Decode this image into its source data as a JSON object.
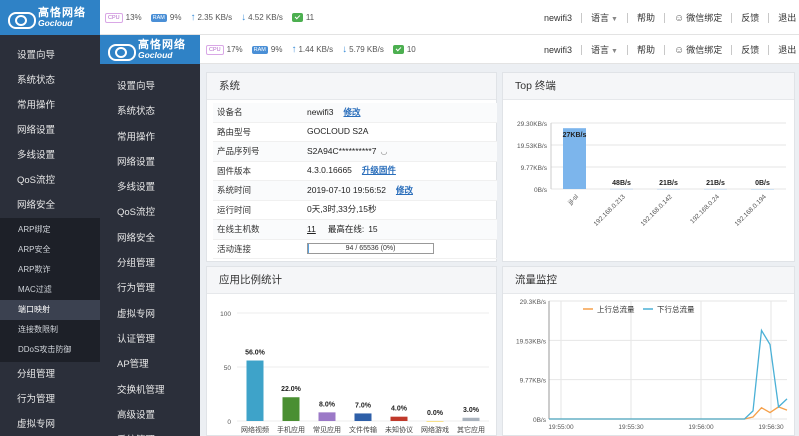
{
  "brand": {
    "name_cn": "高恪网络",
    "name_en": "Gocloud"
  },
  "header_bg": {
    "cpu": "13%",
    "ram": "9%",
    "upload": "2.35 KB/s",
    "download": "4.52 KB/s",
    "devices": "11"
  },
  "header_fg": {
    "cpu": "17%",
    "ram": "9%",
    "upload": "1.44 KB/s",
    "download": "5.79 KB/s",
    "devices": "10"
  },
  "badges": {
    "cpu": "CPU",
    "ram": "RAM"
  },
  "topnav": {
    "device": "newifi3",
    "language": "语言",
    "help": "帮助",
    "wechat": "微信绑定",
    "feedback": "反馈",
    "logout": "退出"
  },
  "sidebar_bg": {
    "items_top": [
      "设置向导",
      "系统状态",
      "常用操作",
      "网络设置",
      "多线设置",
      "QoS流控",
      "网络安全"
    ],
    "sub_items": [
      "ARP绑定",
      "ARP安全",
      "ARP欺诈",
      "MAC过滤",
      "端口映射",
      "连接数限制",
      "DDoS攻击防御"
    ],
    "items_bottom": [
      "分组管理",
      "行为管理",
      "虚拟专网"
    ]
  },
  "sidebar_fg": {
    "items": [
      "设置向导",
      "系统状态",
      "常用操作",
      "网络设置",
      "多线设置",
      "QoS流控",
      "网络安全",
      "分组管理",
      "行为管理",
      "虚拟专网",
      "认证管理",
      "AP管理",
      "交换机管理",
      "高级设置",
      "系统管理"
    ]
  },
  "system_panel": {
    "title": "系统",
    "rows": {
      "device_name": {
        "label": "设备名",
        "value": "newifi3",
        "action": "修改"
      },
      "model": {
        "label": "路由型号",
        "value": "GOCLOUD S2A"
      },
      "serial": {
        "label": "产品序列号",
        "value": "S2A94C**********7"
      },
      "firmware": {
        "label": "固件版本",
        "value": "4.3.0.16665",
        "action": "升级固件"
      },
      "time": {
        "label": "系统时间",
        "value": "2019-07-10 19:56:52",
        "action": "修改"
      },
      "uptime": {
        "label": "运行时间",
        "value": "0天,3时,33分,15秒"
      },
      "hosts": {
        "label": "在线主机数",
        "value": "11",
        "max_label": "最高在线:",
        "max_value": "15"
      },
      "connections": {
        "label": "活动连接",
        "value": "94 / 65536 (0%)",
        "fraction": 0.0014
      }
    }
  },
  "top_panel": {
    "title": "Top 终端"
  },
  "app_panel": {
    "title": "应用比例统计"
  },
  "traffic_panel": {
    "title": "流量监控"
  },
  "chart_data": [
    {
      "type": "bar",
      "categories": [
        "jjl-sl",
        "192.168.0.213",
        "192.168.0.142",
        "192.168.0.24",
        "192.168.0.194"
      ],
      "values": [
        27,
        0.048,
        0.021,
        0.021,
        0
      ],
      "labels": [
        "27KB/s",
        "48B/s",
        "21B/s",
        "21B/s",
        "0B/s"
      ],
      "yticks": [
        "29.30KB/s",
        "19.53KB/s",
        "9.77KB/s",
        "0B/s"
      ],
      "ylim": [
        0,
        29.3
      ],
      "color": "#7cb5ec"
    },
    {
      "type": "bar",
      "categories": [
        "网络视频",
        "手机应用",
        "常见应用",
        "文件传输",
        "未知协议",
        "网络游戏",
        "其它应用"
      ],
      "values": [
        56.0,
        22.0,
        8.0,
        7.0,
        4.0,
        0.0,
        3.0
      ],
      "labels": [
        "56.0%",
        "22.0%",
        "8.0%",
        "7.0%",
        "4.0%",
        "0.0%",
        "3.0%"
      ],
      "colors": [
        "#3ea3c9",
        "#4a8f32",
        "#9b79c7",
        "#2e5fa8",
        "#c0392b",
        "#f0c419",
        "#aab3bd"
      ],
      "yticks": [
        "100",
        "50",
        "0"
      ],
      "ylim": [
        0,
        100
      ]
    },
    {
      "type": "line",
      "series": [
        {
          "name": "上行总流量",
          "color": "#f5a04a",
          "values": [
            0,
            0,
            0,
            0,
            0,
            0,
            0,
            0,
            0,
            0,
            0,
            0,
            0,
            0,
            0,
            0,
            0,
            0,
            0,
            0,
            0,
            0,
            0,
            0,
            0.5,
            2.8,
            1.6,
            3.0,
            2.2
          ]
        },
        {
          "name": "下行总流量",
          "color": "#4ab0d6",
          "values": [
            0,
            0,
            0,
            0,
            0,
            0,
            0,
            0,
            0,
            0,
            0,
            0,
            0,
            0,
            0,
            0,
            0,
            0,
            0,
            0,
            0,
            0,
            0,
            0,
            2.0,
            22.0,
            18.5,
            3.0,
            5.0
          ]
        }
      ],
      "xticks": [
        "19:55:00",
        "19:55:30",
        "19:56:00",
        "19:56:30"
      ],
      "yticks": [
        "29.3KB/s",
        "19.53KB/s",
        "9.77KB/s",
        "0B/s"
      ],
      "ylim": [
        0,
        29.3
      ]
    }
  ]
}
